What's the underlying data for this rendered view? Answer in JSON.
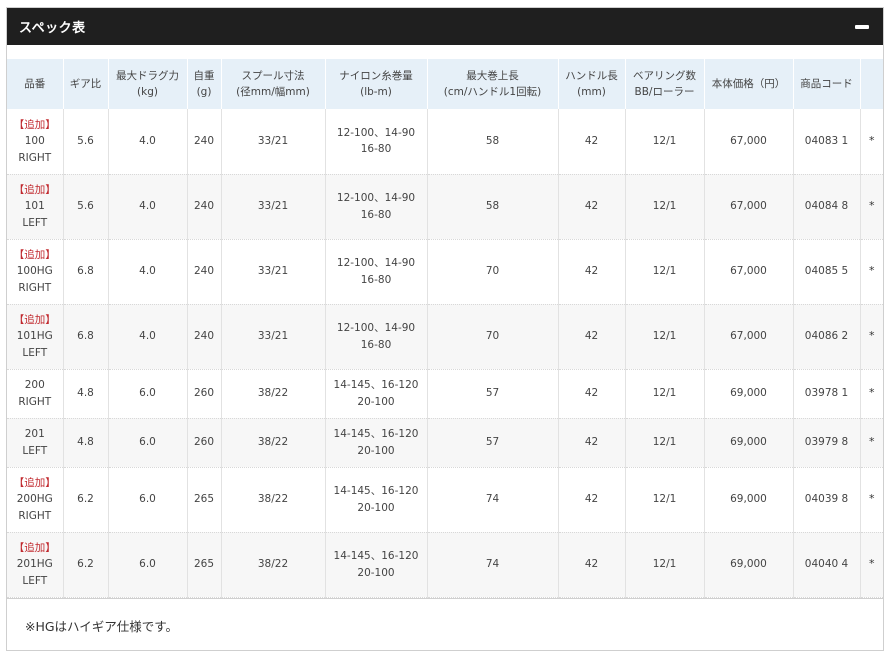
{
  "panel": {
    "title": "スペック表",
    "collapse_label": "collapse"
  },
  "table": {
    "headers": [
      [
        "品番"
      ],
      [
        "ギア比"
      ],
      [
        "最大ドラグ力",
        "(kg)"
      ],
      [
        "自重",
        "(g)"
      ],
      [
        "スプール寸法",
        "(径mm/幅mm)"
      ],
      [
        "ナイロン糸巻量",
        "(lb-m)"
      ],
      [
        "最大巻上長",
        "(cm/ハンドル1回転)"
      ],
      [
        "ハンドル長",
        "(mm)"
      ],
      [
        "ベアリング数",
        "BB/ローラー"
      ],
      [
        "本体価格（円）"
      ],
      [
        "商品コード"
      ],
      [
        ""
      ]
    ],
    "rows": [
      {
        "added": "【追加】",
        "model": [
          "100",
          "RIGHT"
        ],
        "gear": "5.6",
        "drag": "4.0",
        "weight": "240",
        "spool": "33/21",
        "line": [
          "12-100、14-90",
          "16-80"
        ],
        "retrieve": "58",
        "handle": "42",
        "bearing": "12/1",
        "price": "67,000",
        "code": "04083 1",
        "mark": "*"
      },
      {
        "added": "【追加】",
        "model": [
          "101",
          "LEFT"
        ],
        "gear": "5.6",
        "drag": "4.0",
        "weight": "240",
        "spool": "33/21",
        "line": [
          "12-100、14-90",
          "16-80"
        ],
        "retrieve": "58",
        "handle": "42",
        "bearing": "12/1",
        "price": "67,000",
        "code": "04084 8",
        "mark": "*"
      },
      {
        "added": "【追加】",
        "model": [
          "100HG",
          "RIGHT"
        ],
        "gear": "6.8",
        "drag": "4.0",
        "weight": "240",
        "spool": "33/21",
        "line": [
          "12-100、14-90",
          "16-80"
        ],
        "retrieve": "70",
        "handle": "42",
        "bearing": "12/1",
        "price": "67,000",
        "code": "04085 5",
        "mark": "*"
      },
      {
        "added": "【追加】",
        "model": [
          "101HG",
          "LEFT"
        ],
        "gear": "6.8",
        "drag": "4.0",
        "weight": "240",
        "spool": "33/21",
        "line": [
          "12-100、14-90",
          "16-80"
        ],
        "retrieve": "70",
        "handle": "42",
        "bearing": "12/1",
        "price": "67,000",
        "code": "04086 2",
        "mark": "*"
      },
      {
        "added": "",
        "model": [
          "200",
          "RIGHT"
        ],
        "gear": "4.8",
        "drag": "6.0",
        "weight": "260",
        "spool": "38/22",
        "line": [
          "14-145、16-120",
          "20-100"
        ],
        "retrieve": "57",
        "handle": "42",
        "bearing": "12/1",
        "price": "69,000",
        "code": "03978 1",
        "mark": "*"
      },
      {
        "added": "",
        "model": [
          "201",
          "LEFT"
        ],
        "gear": "4.8",
        "drag": "6.0",
        "weight": "260",
        "spool": "38/22",
        "line": [
          "14-145、16-120",
          "20-100"
        ],
        "retrieve": "57",
        "handle": "42",
        "bearing": "12/1",
        "price": "69,000",
        "code": "03979 8",
        "mark": "*"
      },
      {
        "added": "【追加】",
        "model": [
          "200HG",
          "RIGHT"
        ],
        "gear": "6.2",
        "drag": "6.0",
        "weight": "265",
        "spool": "38/22",
        "line": [
          "14-145、16-120",
          "20-100"
        ],
        "retrieve": "74",
        "handle": "42",
        "bearing": "12/1",
        "price": "69,000",
        "code": "04039 8",
        "mark": "*"
      },
      {
        "added": "【追加】",
        "model": [
          "201HG",
          "LEFT"
        ],
        "gear": "6.2",
        "drag": "6.0",
        "weight": "265",
        "spool": "38/22",
        "line": [
          "14-145、16-120",
          "20-100"
        ],
        "retrieve": "74",
        "handle": "42",
        "bearing": "12/1",
        "price": "69,000",
        "code": "04040 4",
        "mark": "*"
      }
    ],
    "note": "※HGはハイギア仕様です。"
  },
  "colors": {
    "header_bg": "#1f1f1f",
    "th_bg": "#e6f0f8",
    "added_text": "#c0282d"
  }
}
